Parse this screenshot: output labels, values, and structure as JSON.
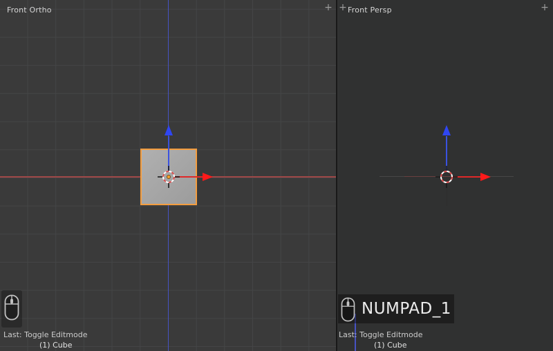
{
  "left_viewport": {
    "label": "Front Ortho",
    "expand_button": "+",
    "screencast": {
      "last_action": "Last: Toggle Editmode",
      "object_info": "(1) Cube"
    }
  },
  "right_viewport": {
    "label": "Front Persp",
    "expand_button_left": "+",
    "expand_button_right": "+",
    "key_pressed": "NUMPAD_1",
    "screencast": {
      "last_action": "Last: Toggle Editmode",
      "object_info": "(1) Cube"
    }
  },
  "colors": {
    "viewport_bg_left": "#3a3a3a",
    "viewport_bg_right": "#303131",
    "grid_line": "#444546",
    "axis_x_line": "#a04848",
    "axis_z_line": "#4753c4",
    "gizmo_x_arrow": "#ff1a1a",
    "gizmo_z_arrow": "#2f46f2",
    "selection_outline": "#f49d3f",
    "cube_fill": "#a6a6a6",
    "origin_dot": "#ffa028",
    "overlay_text": "#cccccc",
    "key_text": "#ececec"
  },
  "icons": {
    "mouse": "mouse-icon",
    "cursor": "3d-cursor-icon",
    "plus": "plus-icon"
  }
}
